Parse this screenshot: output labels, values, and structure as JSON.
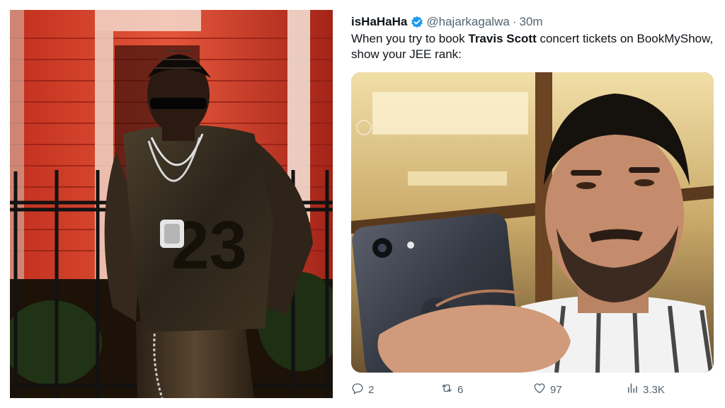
{
  "tweet": {
    "display_name": "isHaHaHa",
    "handle": "@hajarkagalwa",
    "separator": "·",
    "time": "30m",
    "text_before": "When you try to book ",
    "text_bold": "Travis Scott",
    "text_after": " concert tickets on BookMyShow, show your JEE rank:",
    "verified_icon": "verified-badge-icon",
    "accent_color": "#1d9bf0"
  },
  "actions": {
    "reply_count": "2",
    "retweet_count": "6",
    "like_count": "97",
    "views_count": "3.3K"
  },
  "images": {
    "left": {
      "jersey_number": "23"
    }
  }
}
